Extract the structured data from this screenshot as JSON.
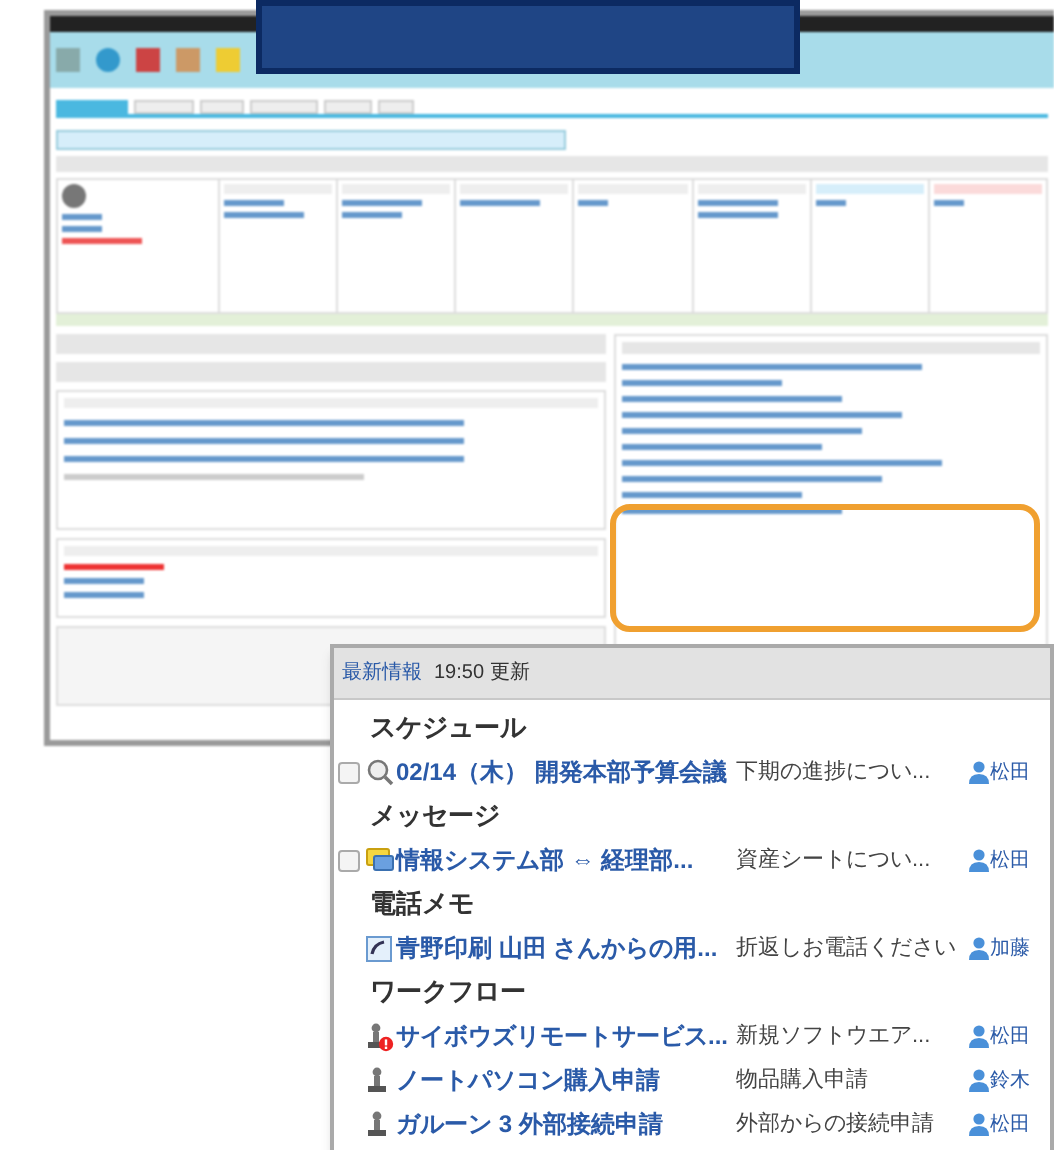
{
  "latest_info": {
    "title": "最新情報",
    "updated": "19:50 更新",
    "sections": [
      {
        "heading": "スケジュール",
        "items": [
          {
            "kind": "schedule",
            "checked": false,
            "title": "02/14（木） 開発本部予算会議",
            "description": "下期の進捗につい...",
            "user": "松田"
          }
        ]
      },
      {
        "heading": "メッセージ",
        "items": [
          {
            "kind": "message",
            "checked": false,
            "title": "情報システム部 ⇔ 経理部...",
            "description": "資産シートについ...",
            "user": "松田"
          }
        ]
      },
      {
        "heading": "電話メモ",
        "items": [
          {
            "kind": "phone_memo",
            "title": "青野印刷 山田 さんからの用...",
            "description": "折返しお電話ください",
            "user": "加藤"
          }
        ]
      },
      {
        "heading": "ワークフロー",
        "items": [
          {
            "kind": "workflow_alert",
            "title": "サイボウズリモートサービス...",
            "description": "新規ソフトウエア...",
            "user": "松田"
          },
          {
            "kind": "workflow",
            "title": "ノートパソコン購入申請",
            "description": "物品購入申請",
            "user": "鈴木"
          },
          {
            "kind": "workflow",
            "title": "ガルーン 3 外部接続申請",
            "description": "外部からの接続申請",
            "user": "松田"
          }
        ]
      }
    ]
  }
}
